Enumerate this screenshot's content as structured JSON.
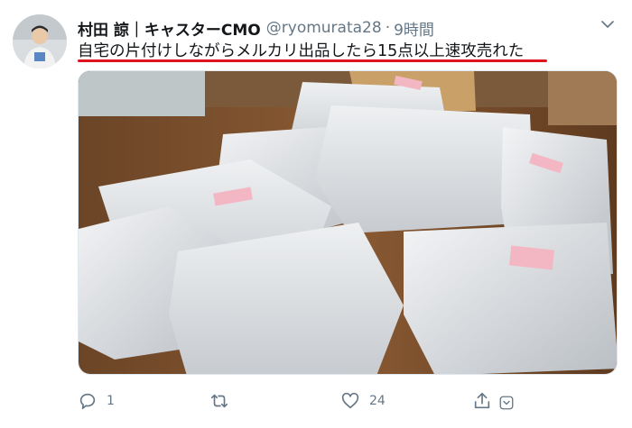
{
  "author": {
    "name": "村田 諒｜キャスターCMO",
    "handle": "@ryomurata28",
    "separator": "·",
    "time": "9時間"
  },
  "tweet": {
    "text": "自宅の片付けしながらメルカリ出品したら15点以上速攻売れた",
    "underline_color": "#e0141e"
  },
  "actions": {
    "reply_count": "1",
    "retweet_count": "",
    "like_count": "24",
    "share_count": ""
  },
  "icons": {
    "menu": "chevron-down-icon",
    "reply": "comment-icon",
    "retweet": "retweet-icon",
    "like": "heart-icon",
    "share": "share-icon"
  },
  "colors": {
    "text_primary": "#14171a",
    "text_secondary": "#657786",
    "accent_red": "#e0141e"
  }
}
